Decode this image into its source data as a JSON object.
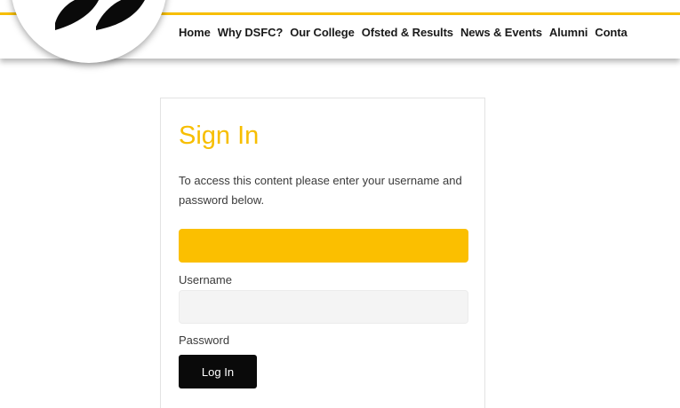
{
  "header": {
    "nav_items": [
      {
        "label": "Home"
      },
      {
        "label": "Why DSFC?"
      },
      {
        "label": "Our College"
      },
      {
        "label": "Ofsted & Results"
      },
      {
        "label": "News & Events"
      },
      {
        "label": "Alumni"
      },
      {
        "label": "Conta"
      }
    ],
    "accent_color": "#f7be00"
  },
  "sign_in": {
    "title": "Sign In",
    "description": "To access this content please enter your username and password below.",
    "alert_color": "#fbbf00",
    "username_label": "Username",
    "username_value": "",
    "password_label": "Password",
    "login_button_label": "Log In"
  },
  "icons": {
    "logo": "college-logo-mark"
  }
}
